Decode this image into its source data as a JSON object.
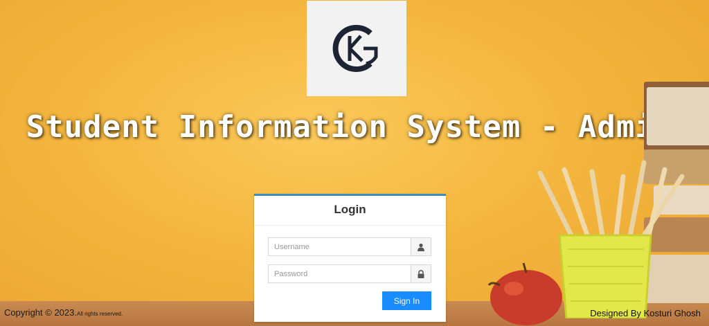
{
  "logo": {
    "letters": "KG"
  },
  "header": {
    "title": "Student Information System - Admin"
  },
  "login": {
    "title": "Login",
    "username_placeholder": "Username",
    "password_placeholder": "Password",
    "signin_label": "Sign In"
  },
  "footer": {
    "copyright": "Copyright © 2023.",
    "rights": "All rights reserved.",
    "designer": "Designed By Kosturi Ghosh"
  },
  "icons": {
    "user": "user-icon",
    "lock": "lock-icon"
  },
  "colors": {
    "accent": "#3c8dbc",
    "button": "#1a8cff",
    "background": "#f4b63e"
  }
}
